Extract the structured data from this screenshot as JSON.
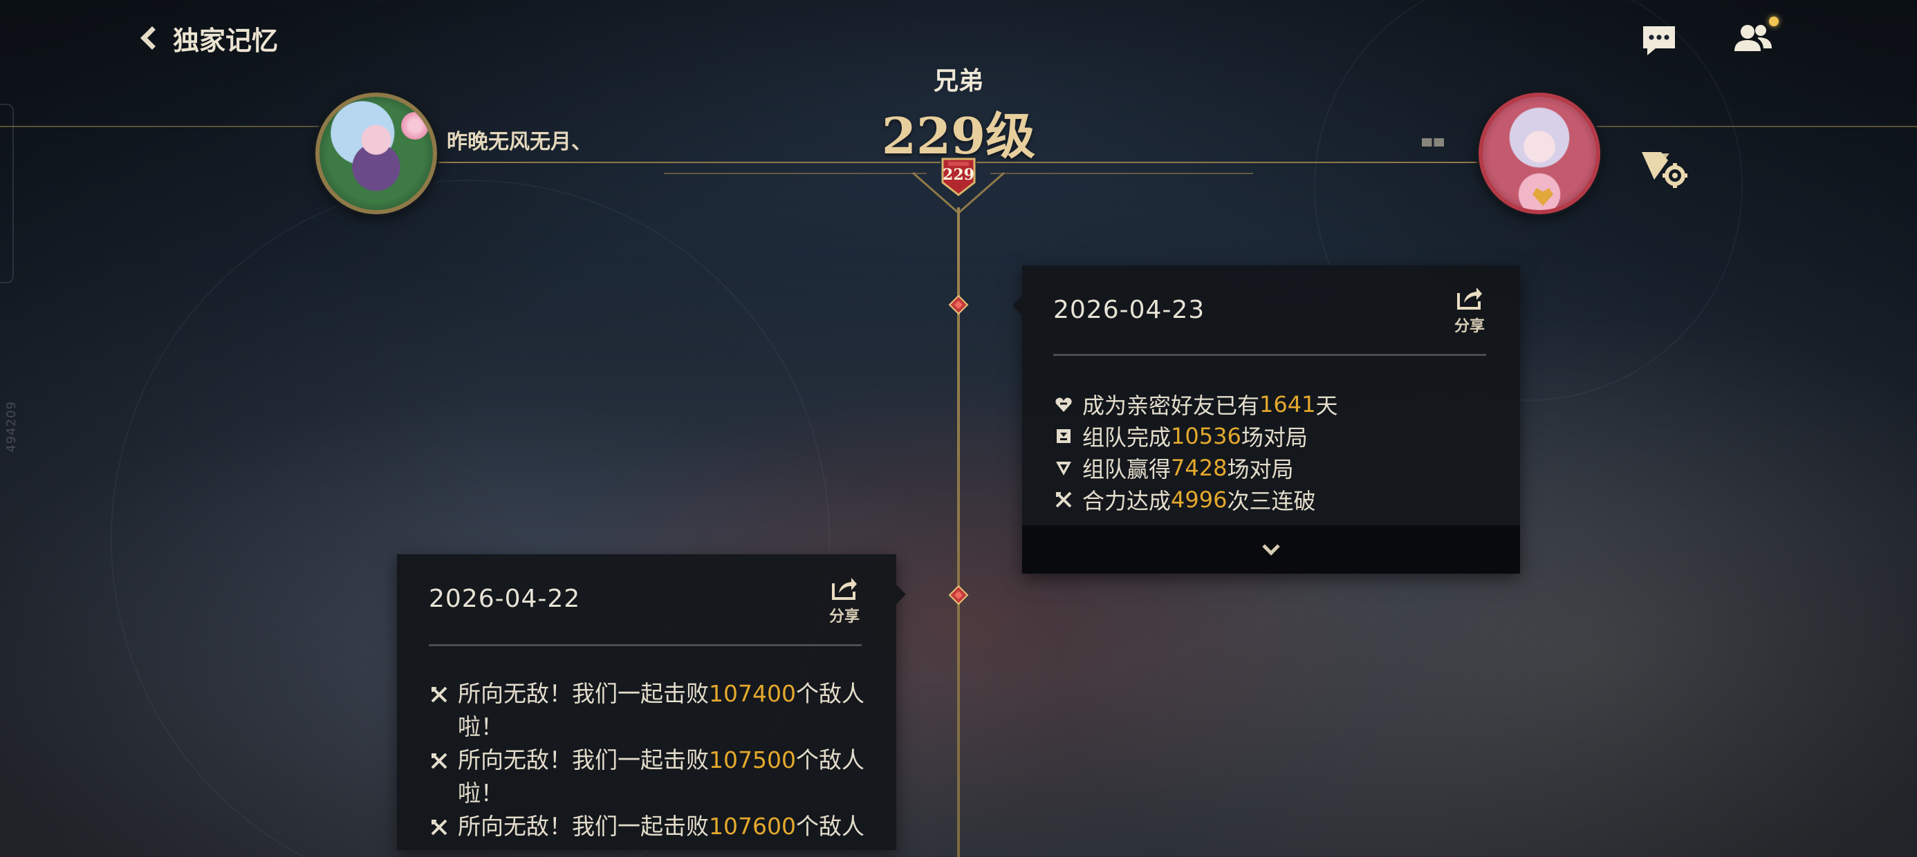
{
  "header": {
    "back_title": "独家记忆"
  },
  "relation": {
    "type": "兄弟",
    "level_text": "229级",
    "badge_level": "229"
  },
  "players": {
    "left_name": "昨晚无风无月、"
  },
  "side_code": "494209",
  "cards": [
    {
      "date": "2026-04-23",
      "share_label": "分享",
      "stats": [
        {
          "icon": "heart-link-icon",
          "prefix": "成为亲密好友已有",
          "value": "1641",
          "suffix": "天"
        },
        {
          "icon": "team-flag-icon",
          "prefix": "组队完成",
          "value": "10536",
          "suffix": "场对局"
        },
        {
          "icon": "victory-badge-icon",
          "prefix": "组队赢得",
          "value": "7428",
          "suffix": "场对局"
        },
        {
          "icon": "crossed-swords-icon",
          "prefix": "合力达成",
          "value": "4996",
          "suffix": "次三连破"
        }
      ]
    },
    {
      "date": "2026-04-22",
      "share_label": "分享",
      "stats": [
        {
          "icon": "crossed-swords-icon",
          "prefix": "所向无敌！我们一起击败",
          "value": "107400",
          "suffix": "个敌人啦！"
        },
        {
          "icon": "crossed-swords-icon",
          "prefix": "所向无敌！我们一起击败",
          "value": "107500",
          "suffix": "个敌人啦！"
        },
        {
          "icon": "crossed-swords-icon",
          "prefix": "所向无敌！我们一起击败",
          "value": "107600",
          "suffix": "个敌人"
        }
      ]
    }
  ],
  "colors": {
    "gold_line": "#8f7948",
    "highlight": "#e5a92d",
    "card_bg": "#12161a",
    "timeline_node": "#c23a3a"
  }
}
